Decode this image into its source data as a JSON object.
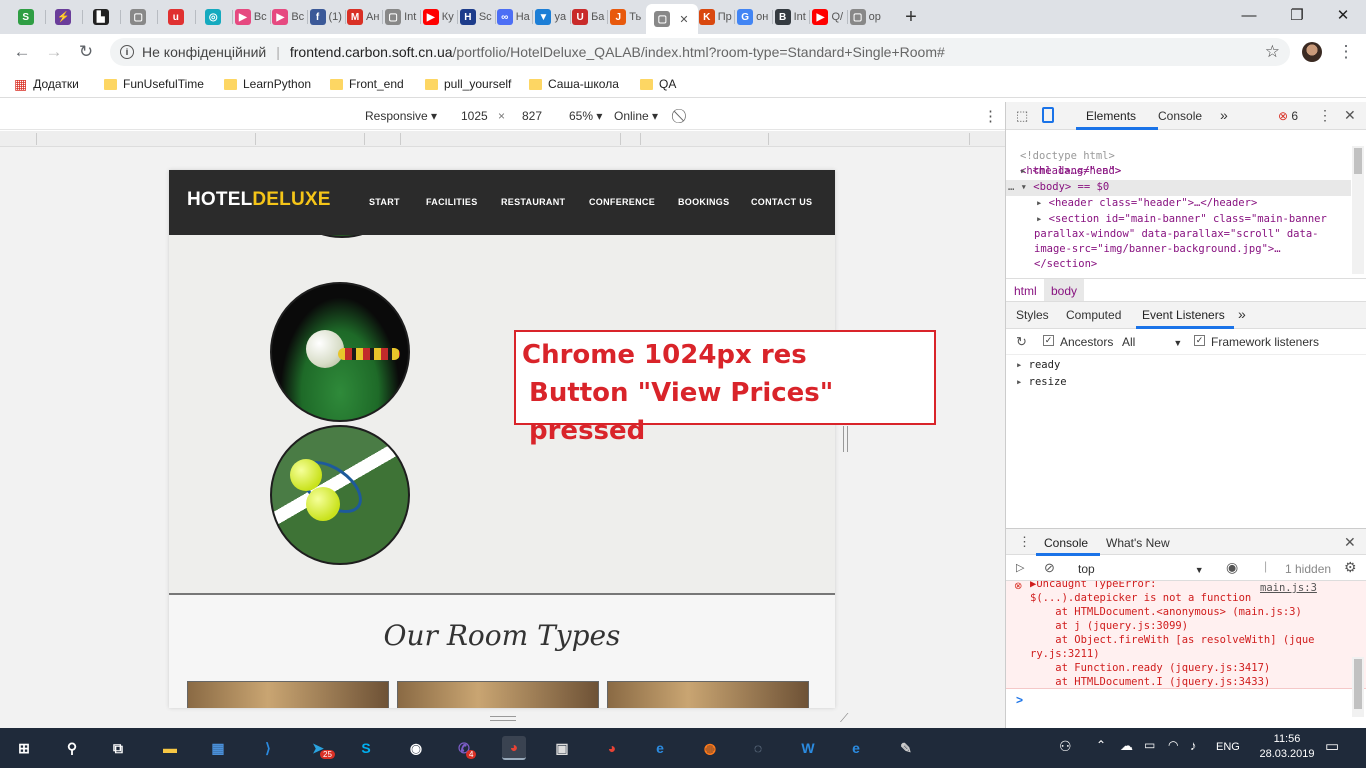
{
  "browser": {
    "tabs": [
      {
        "label": "",
        "icon": "S",
        "color": "#2f9e44"
      },
      {
        "label": "",
        "icon": "⚡",
        "color": "#6a3d9a"
      },
      {
        "label": "",
        "icon": "▙",
        "color": "#222222"
      },
      {
        "label": "",
        "icon": "▢",
        "color": "#888888"
      },
      {
        "label": "",
        "icon": "u",
        "color": "#e03131"
      },
      {
        "label": "",
        "icon": "◎",
        "color": "#15aabf"
      },
      {
        "label": "Вс",
        "icon": "▶",
        "color": "#e64980"
      },
      {
        "label": "Вс",
        "icon": "▶",
        "color": "#e64980"
      },
      {
        "label": "(1)",
        "icon": "f",
        "color": "#3b5998"
      },
      {
        "label": "Ан",
        "icon": "M",
        "color": "#d93025"
      },
      {
        "label": "Int",
        "icon": "▢",
        "color": "#888888"
      },
      {
        "label": "Ку",
        "icon": "▶",
        "color": "#ff0000"
      },
      {
        "label": "Sc",
        "icon": "H",
        "color": "#1d3c8b"
      },
      {
        "label": "На",
        "icon": "∞",
        "color": "#4c6ef5"
      },
      {
        "label": "ya",
        "icon": "▼",
        "color": "#1c7ed6"
      },
      {
        "label": "Ба",
        "icon": "U",
        "color": "#c92a2a"
      },
      {
        "label": "Ть",
        "icon": "J",
        "color": "#e8590c"
      },
      {
        "label": "",
        "icon": "▢",
        "color": "#888888",
        "active": true
      },
      {
        "label": "Пр",
        "icon": "K",
        "color": "#d9480f"
      },
      {
        "label": "он",
        "icon": "G",
        "color": "#4285f4"
      },
      {
        "label": "Int",
        "icon": "B",
        "color": "#343a40"
      },
      {
        "label": "Q/",
        "icon": "▶",
        "color": "#ff0000"
      },
      {
        "label": "ор",
        "icon": "▢",
        "color": "#888888"
      }
    ],
    "close_tab": "✕",
    "new_tab": "+",
    "window_controls": {
      "minimize": "—",
      "restore": "❐",
      "close": "✕"
    },
    "nav": {
      "back": "←",
      "forward": "→",
      "reload": "↻"
    },
    "security_label": "Не конфіденційний",
    "url_host": "frontend.carbon.soft.cn.ua",
    "url_path": "/portfolio/HotelDeluxe_QALAB/index.html?room-type=Standard+Single+Room#",
    "star": "☆",
    "menu": "⋮",
    "bookmarks": [
      {
        "label": "Додатки",
        "type": "apps"
      },
      {
        "label": "FunUsefulTime",
        "type": "folder"
      },
      {
        "label": "LearnPython",
        "type": "folder"
      },
      {
        "label": "Front_end",
        "type": "folder"
      },
      {
        "label": "pull_yourself",
        "type": "folder"
      },
      {
        "label": "Саша-школа",
        "type": "folder"
      },
      {
        "label": "QA",
        "type": "folder"
      }
    ]
  },
  "device_toolbar": {
    "mode": "Responsive",
    "width": "1025",
    "times": "×",
    "height": "827",
    "zoom": "65%",
    "network": "Online"
  },
  "site": {
    "logo_white": "HOTEL",
    "logo_yellow": "DELUXE",
    "nav": [
      "START",
      "FACILITIES",
      "RESTAURANT",
      "CONFERENCE",
      "BOOKINGS",
      "CONTACT US"
    ],
    "section_title": "Our Room Types",
    "colors": {
      "nav_bg": "#2b2b2b",
      "logo_accent": "#f5c518",
      "annotation": "#d9242a"
    }
  },
  "annotation": {
    "line1": "Chrome 1024px res",
    "line2": "Button \"View Prices\" pressed"
  },
  "devtools": {
    "tabs": [
      "Elements",
      "Console"
    ],
    "more": "»",
    "error_count": "6",
    "dom": {
      "doctype": "<!doctype html>",
      "html_open": "<html lang=\"en\">",
      "head": "<head>…</head>",
      "body": "<body> == $0",
      "header": "<header class=\"header\">…</header>",
      "section_1": "<section id=\"main-banner\" class=\"main-banner",
      "section_2": "parallax-window\" data-parallax=\"scroll\" data-",
      "section_3": "image-src=\"img/banner-background.jpg\">…",
      "section_close": "</section>"
    },
    "breadcrumbs": [
      "html",
      "body"
    ],
    "sidebar_tabs": [
      "Styles",
      "Computed",
      "Event Listeners"
    ],
    "ancestors_label": "Ancestors",
    "ancestors_value": "All",
    "framework_label": "Framework listeners",
    "listeners": [
      "ready",
      "resize"
    ],
    "drawer_tabs": [
      "Console",
      "What's New"
    ],
    "context": "top",
    "hidden_count": "1 hidden",
    "console_lines": [
      "▶Uncaught TypeError:",
      "$(...).datepicker is not a function",
      "    at HTMLDocument.<anonymous> (main.js:3)",
      "    at j (jquery.js:3099)",
      "    at Object.fireWith [as resolveWith] (jque",
      "ry.js:3211)",
      "    at Function.ready (jquery.js:3417)",
      "    at HTMLDocument.I (jquery.js:3433)"
    ],
    "console_source": "main.js:3",
    "prompt": ">"
  },
  "taskbar": {
    "apps": [
      {
        "name": "start",
        "glyph": "⊞",
        "color": "#ffffff"
      },
      {
        "name": "search",
        "glyph": "⚲",
        "color": "#ffffff"
      },
      {
        "name": "task-view",
        "glyph": "⧉",
        "color": "#ffffff"
      },
      {
        "name": "file-explorer",
        "glyph": "▬",
        "color": "#f6c744"
      },
      {
        "name": "store",
        "glyph": "▦",
        "color": "#4a90d9"
      },
      {
        "name": "vscode",
        "glyph": "⟩",
        "color": "#2b8be0"
      },
      {
        "name": "telegram",
        "glyph": "➤",
        "color": "#2aa3df"
      },
      {
        "name": "skype",
        "glyph": "S",
        "color": "#00aff0"
      },
      {
        "name": "camera",
        "glyph": "◉",
        "color": "#ffffff"
      },
      {
        "name": "viber",
        "glyph": "✆",
        "color": "#7d5dc9"
      },
      {
        "name": "chrome",
        "glyph": "◕",
        "color": "#e84335"
      },
      {
        "name": "app",
        "glyph": "▣",
        "color": "#dddddd"
      },
      {
        "name": "chrome-2",
        "glyph": "◕",
        "color": "#e84335"
      },
      {
        "name": "ie",
        "glyph": "e",
        "color": "#2b8be0"
      },
      {
        "name": "firefox",
        "glyph": "◍",
        "color": "#ff7a1a"
      },
      {
        "name": "globe",
        "glyph": "◌",
        "color": "#9fb3c8"
      },
      {
        "name": "word",
        "glyph": "W",
        "color": "#2b8be0"
      },
      {
        "name": "edge",
        "glyph": "e",
        "color": "#2b8be0"
      },
      {
        "name": "paint",
        "glyph": "✎",
        "color": "#cccccc"
      }
    ],
    "telegram_badge": "25",
    "viber_badge": "4",
    "lang": "ENG",
    "time": "11:56",
    "date": "28.03.2019"
  }
}
